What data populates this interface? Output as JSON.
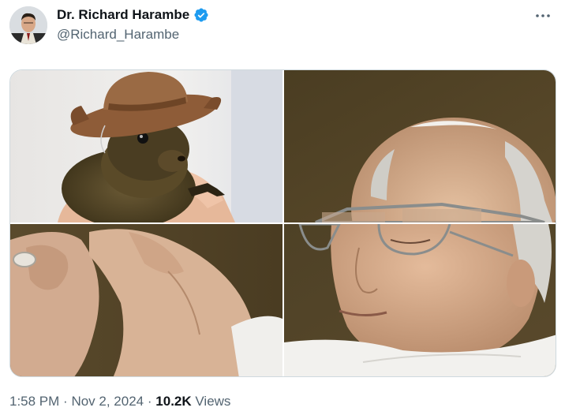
{
  "author": {
    "display_name": "Dr. Richard Harambe",
    "handle": "@Richard_Harambe",
    "verified": true
  },
  "icons": {
    "verified": "verified-badge-icon",
    "more": "more-options-icon"
  },
  "media": {
    "images": [
      "squirrel-wearing-cowboy-hat",
      "pope-face-top",
      "hands-holding-item",
      "pope-face-bottom"
    ]
  },
  "meta": {
    "time": "1:58 PM",
    "separator": "·",
    "date": "Nov 2, 2024",
    "views_count": "10.2K",
    "views_label": "Views"
  },
  "colors": {
    "text_primary": "#0f1419",
    "text_secondary": "#536471",
    "verified_blue": "#1d9bf0",
    "border": "#cfd9de"
  }
}
